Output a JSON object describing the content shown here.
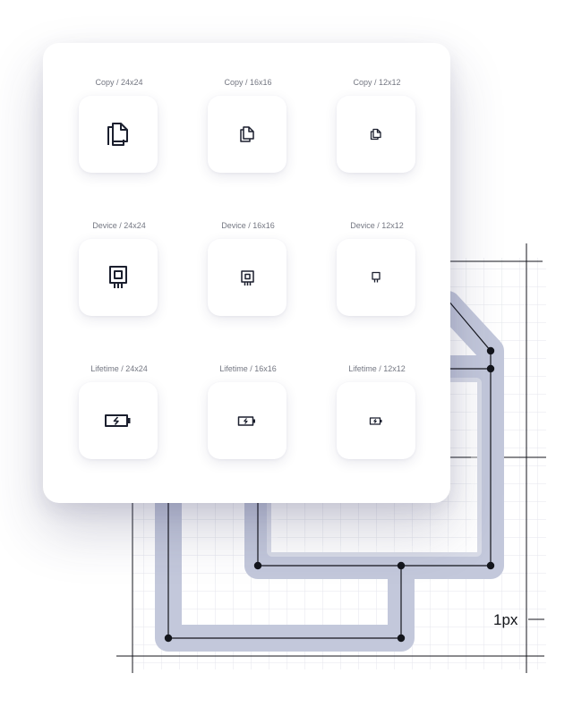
{
  "icon_grid": {
    "rows": [
      {
        "name": "Copy",
        "cells": [
          {
            "label": "Copy / 24x24",
            "icon": "copy-icon"
          },
          {
            "label": "Copy / 16x16",
            "icon": "copy-icon"
          },
          {
            "label": "Copy / 12x12",
            "icon": "copy-icon"
          }
        ]
      },
      {
        "name": "Device",
        "cells": [
          {
            "label": "Device / 24x24",
            "icon": "device-icon"
          },
          {
            "label": "Device / 16x16",
            "icon": "device-icon"
          },
          {
            "label": "Device / 12x12",
            "icon": "device-icon"
          }
        ]
      },
      {
        "name": "Lifetime",
        "cells": [
          {
            "label": "Lifetime / 24x24",
            "icon": "battery-charging-icon"
          },
          {
            "label": "Lifetime / 16x16",
            "icon": "battery-charging-icon"
          },
          {
            "label": "Lifetime / 12x12",
            "icon": "battery-charging-icon"
          }
        ]
      }
    ]
  },
  "stroke_annotation": {
    "label": "1px"
  },
  "colors": {
    "icon_stroke": "#1b1f2e",
    "stroke_highlight": "#c3c8db",
    "grid_line": "#e4e6ec",
    "construction_line": "#14161c",
    "label_text": "#747782"
  }
}
